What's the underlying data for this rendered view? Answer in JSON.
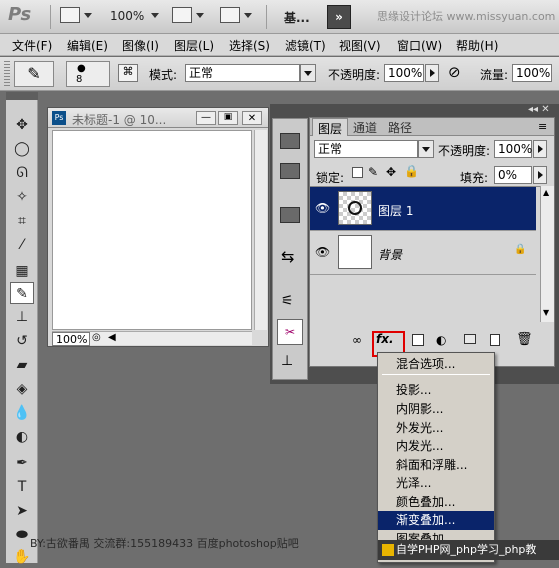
{
  "appbar": {
    "logo": "Ps",
    "zoom": "100%",
    "workspace": "基...",
    "watermark": "思缘设计论坛 www.missyuan.com"
  },
  "menubar": {
    "items": [
      "文件(F)",
      "编辑(E)",
      "图像(I)",
      "图层(L)",
      "选择(S)",
      "滤镜(T)",
      "视图(V)",
      "窗口(W)",
      "帮助(H)"
    ]
  },
  "options": {
    "brush_size": "8",
    "mode_label": "模式:",
    "mode_value": "正常",
    "opacity_label": "不透明度:",
    "opacity_value": "100%",
    "flow_label": "流量:",
    "flow_value": "100%"
  },
  "document": {
    "title": "未标题-1 @ 10...",
    "zoom": "100%"
  },
  "layers_panel": {
    "tabs": [
      "图层",
      "通道",
      "路径"
    ],
    "blend_mode": "正常",
    "opacity_label": "不透明度:",
    "opacity_value": "100%",
    "lock_label": "锁定:",
    "fill_label": "填充:",
    "fill_value": "0%",
    "layers": [
      {
        "name": "图层 1",
        "selected": true
      },
      {
        "name": "背景",
        "selected": false
      }
    ],
    "fx_label": "fx."
  },
  "fx_menu": {
    "items": [
      "混合选项...",
      "投影...",
      "内阴影...",
      "外发光...",
      "内发光...",
      "斜面和浮雕...",
      "光泽...",
      "颜色叠加...",
      "渐变叠加...",
      "图案叠加..."
    ],
    "highlighted": "渐变叠加..."
  },
  "footer": {
    "watermark": "BY:古欲番禺    交流群:155189433    百度photoshop贴吧",
    "badge": "自学PHP网_php学习_php教"
  },
  "colors": {
    "selection": "#0a246a",
    "redbox": "#e00000"
  }
}
